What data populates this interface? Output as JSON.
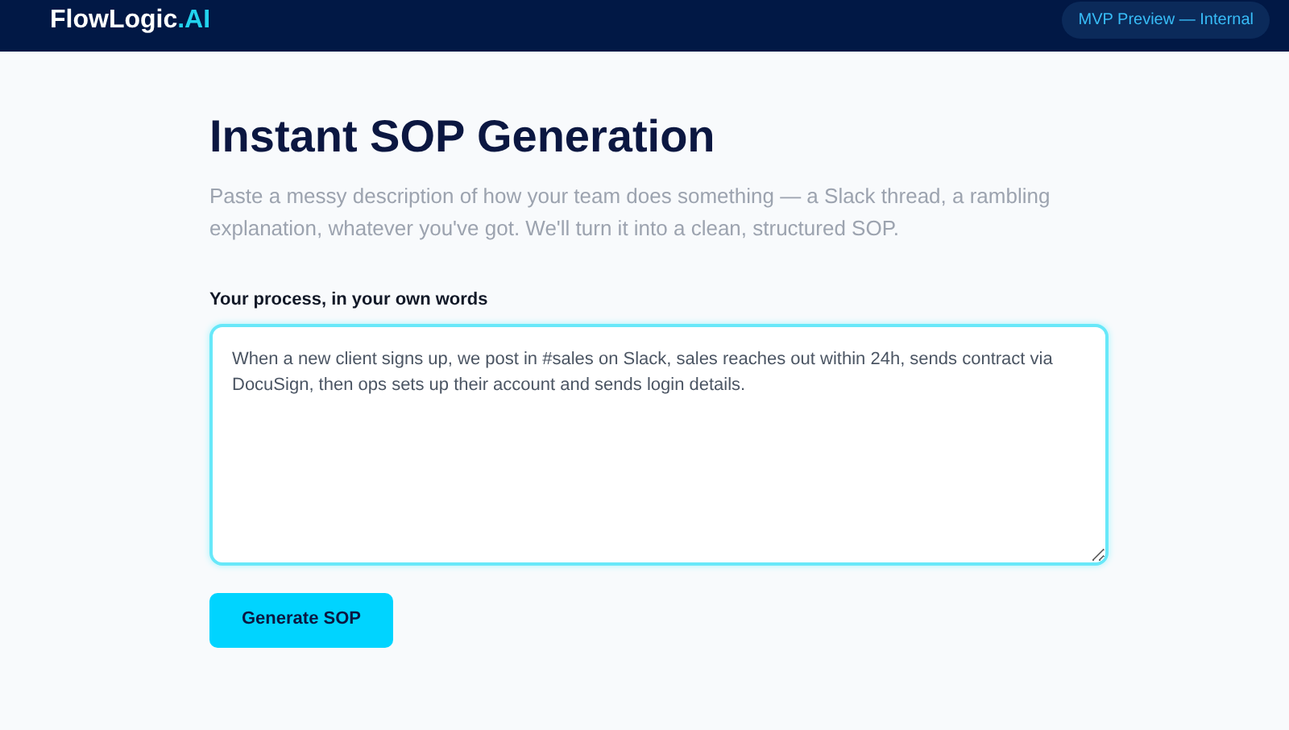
{
  "header": {
    "brand": {
      "name": "FlowLogic",
      "suffix": ".AI"
    },
    "badge": "MVP Preview — Internal"
  },
  "title": "Instant SOP Generation",
  "description": "Paste a messy description of how your team does something — a Slack thread, a rambling explanation, whatever you've got. We'll turn it into a clean, structured SOP.",
  "field": {
    "label": "Your process, in your own words",
    "value": "When a new client signs up, we post in #sales on Slack, sales reaches out within 24h, sends contract via DocuSign, then ops sets up their account and sends login details."
  },
  "button": "Generate SOP"
}
